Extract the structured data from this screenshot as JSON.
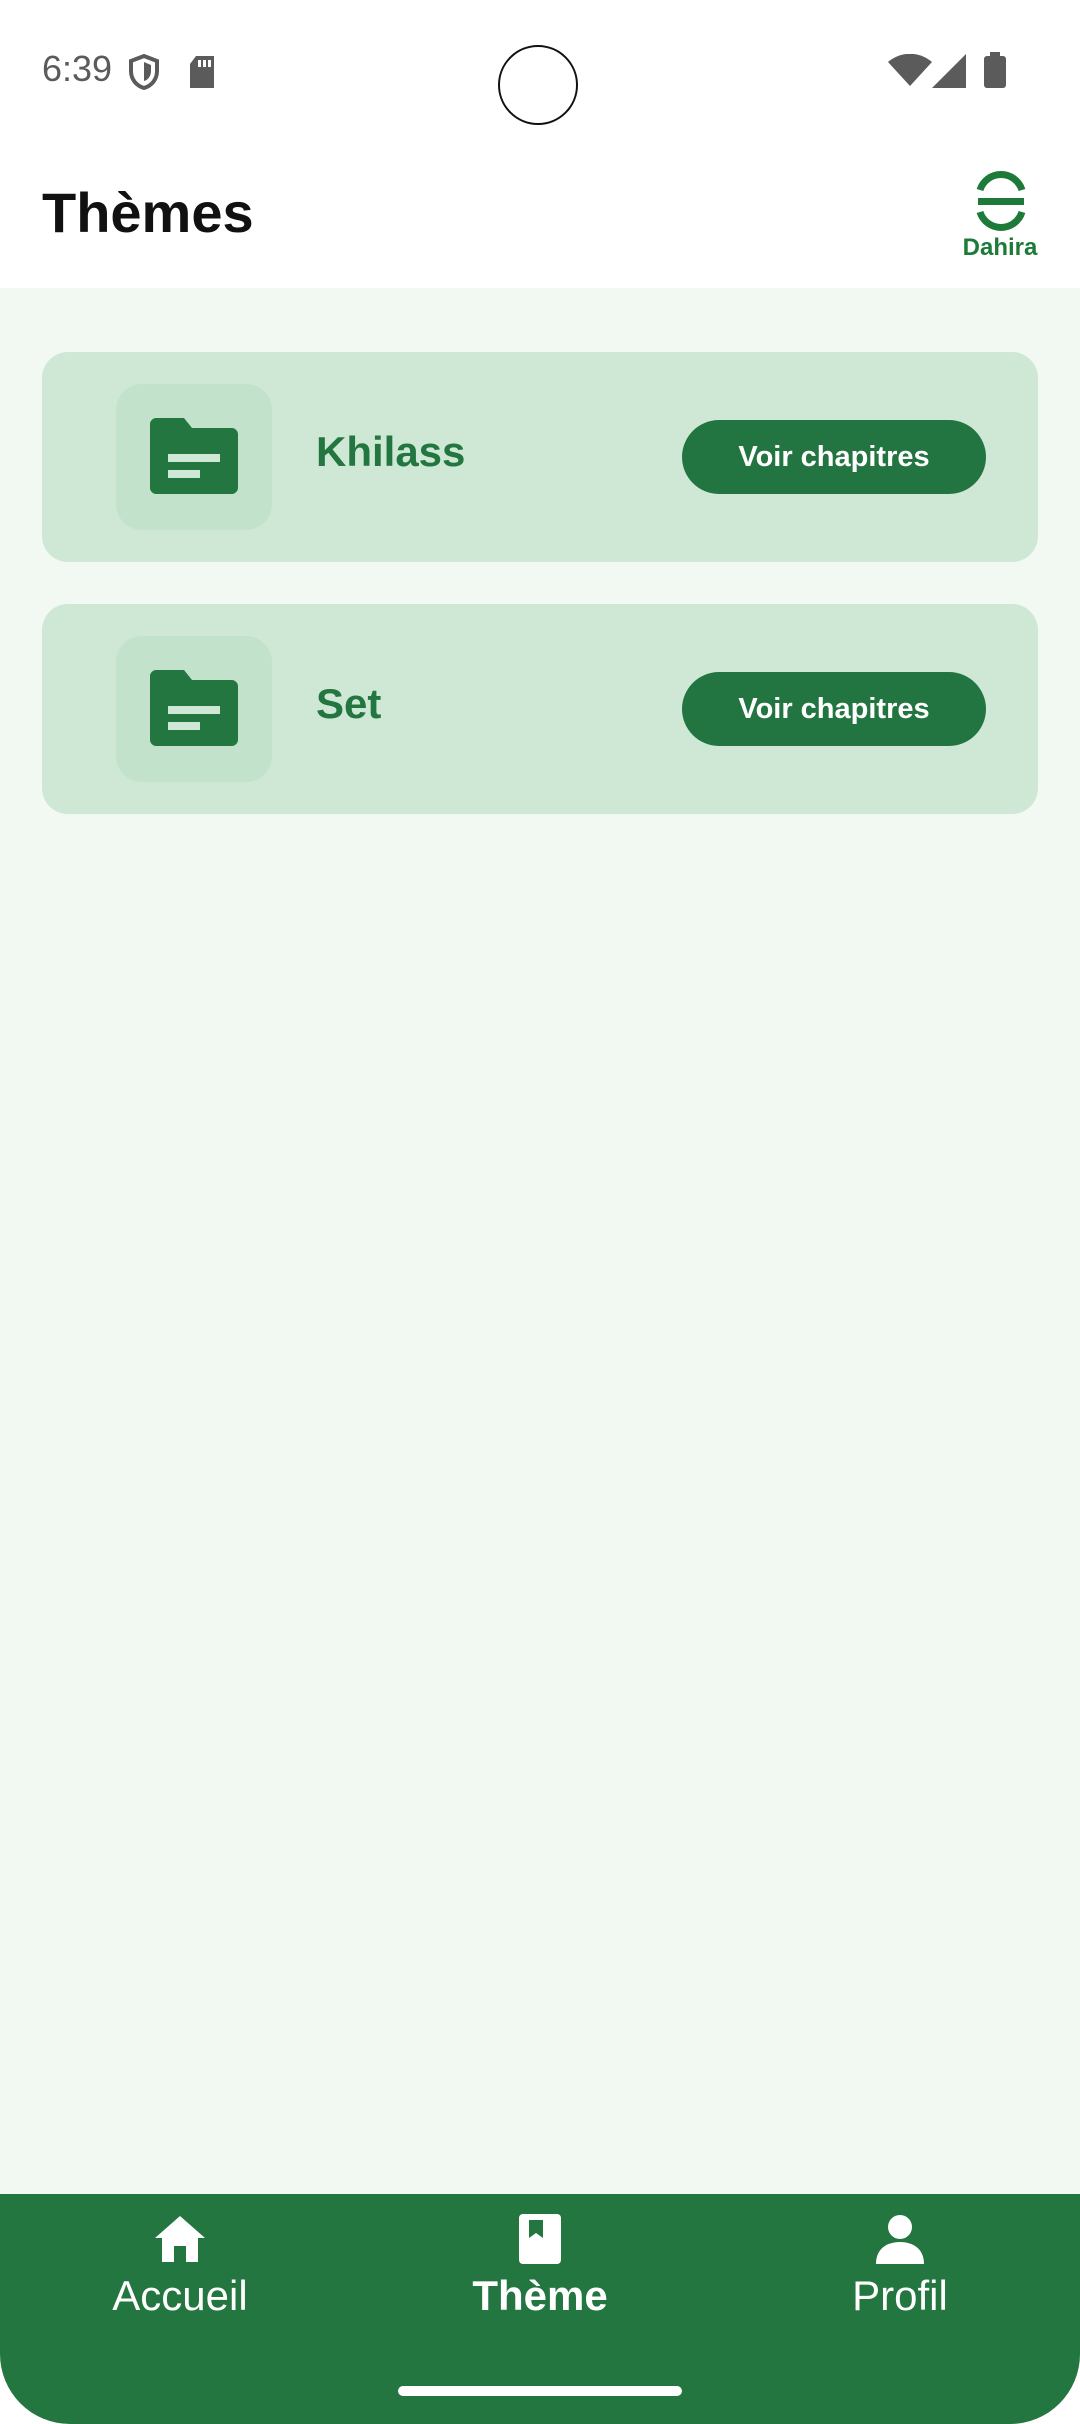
{
  "status_bar": {
    "time": "6:39",
    "icons": [
      "shield-icon",
      "sd-card-icon",
      "wifi-icon",
      "signal-icon",
      "battery-icon"
    ]
  },
  "app_bar": {
    "title": "Thèmes",
    "logo_text": "Dahira"
  },
  "themes": [
    {
      "title": "Khilass",
      "button_label": "Voir chapitres",
      "icon": "folder-icon"
    },
    {
      "title": "Set",
      "button_label": "Voir chapitres",
      "icon": "folder-icon"
    }
  ],
  "bottom_nav": {
    "items": [
      {
        "label": "Accueil",
        "icon": "home-icon",
        "active": false
      },
      {
        "label": "Thème",
        "icon": "book-icon",
        "active": true
      },
      {
        "label": "Profil",
        "icon": "person-icon",
        "active": false
      }
    ]
  },
  "colors": {
    "primary": "#23763f",
    "card_background": "#cfe8d6",
    "page_background": "#f2f8f2"
  }
}
